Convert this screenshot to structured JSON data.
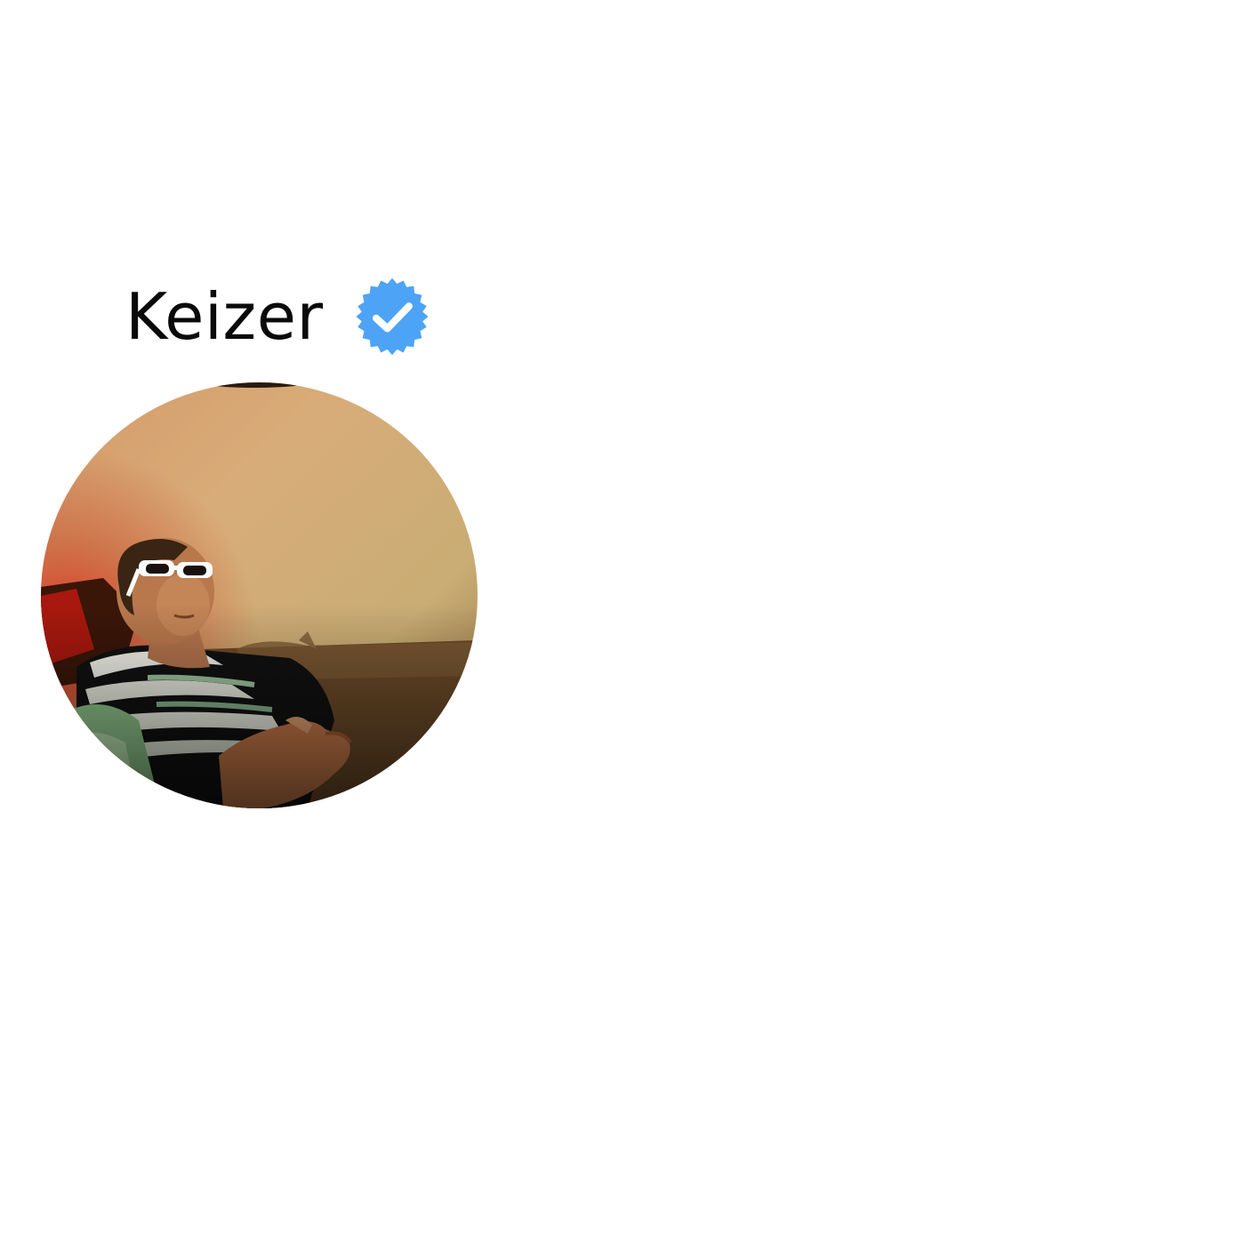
{
  "profile": {
    "name": "Keizer",
    "verified": true,
    "verified_icon": "verified-badge-icon",
    "avatar_icon": "profile-photo"
  },
  "colors": {
    "badge": "#4da3f5",
    "badge_check": "#ffffff",
    "text": "#0a0a0a",
    "background": "#ffffff"
  }
}
